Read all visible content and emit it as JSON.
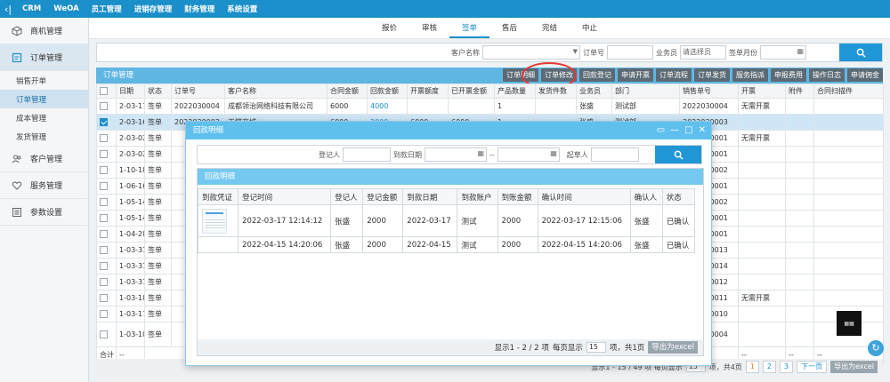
{
  "topnav": {
    "items": [
      "CRM",
      "WeOA",
      "员工管理",
      "进销存管理",
      "财务管理",
      "系统设置"
    ]
  },
  "sidebar": {
    "opportunity": "商机管理",
    "order": "订单管理",
    "subs": [
      "销售开单",
      "订单管理",
      "成本管理",
      "发货管理"
    ],
    "customer": "客户管理",
    "service": "服务管理",
    "params": "参数设置"
  },
  "tabs": [
    "报价",
    "审核",
    "签单",
    "售后",
    "完结",
    "中止"
  ],
  "search": {
    "customer_label": "客户名称",
    "order_label": "订单号",
    "sales_label": "业务员",
    "sales_placeholder": "请选择员",
    "month_label": "签单月份"
  },
  "panel": {
    "title": "订单管理"
  },
  "toolbar": [
    "订单明细",
    "订单修改",
    "回款登记",
    "申请开票",
    "订单流程",
    "订单发货",
    "服务指派",
    "申报费用",
    "操作日志",
    "申请佣金"
  ],
  "table": {
    "headers": [
      "",
      "日期",
      "状态",
      "订单号",
      "客户名称",
      "合同金额",
      "回款金额",
      "开票额度",
      "已开票金额",
      "产品数量",
      "发货件数",
      "业务员",
      "部门",
      "销售单号",
      "开票",
      "附件",
      "合同扫描件"
    ],
    "rows": [
      [
        "2-03-17",
        "签单",
        "2022030004",
        "成都领治网络科技有限公司",
        "6000",
        "4000",
        "",
        "",
        "1",
        "",
        "张盛",
        "测试部",
        "2022030004",
        "无需开票",
        "",
        ""
      ],
      [
        "2-03-16",
        "签单",
        "2022030003",
        "天猫商城",
        "6000",
        "2000",
        "6000",
        "6000",
        "1",
        "",
        "张盛",
        "测试部",
        "2022030003",
        "",
        "",
        ""
      ],
      [
        "2-03-02",
        "签单",
        "",
        "",
        "",
        "",
        "",
        "",
        "",
        "",
        "",
        "",
        "2022030001",
        "无需开票",
        "",
        ""
      ],
      [
        "2-03-02",
        "签单",
        "",
        "",
        "",
        "",
        "",
        "",
        "",
        "",
        "",
        "",
        "2022030001",
        "",
        "",
        ""
      ],
      [
        "1-10-18",
        "签单",
        "",
        "",
        "",
        "",
        "",
        "",
        "",
        "",
        "",
        "",
        "2021100002",
        "",
        "",
        ""
      ],
      [
        "1-06-16",
        "签单",
        "",
        "",
        "",
        "",
        "",
        "",
        "",
        "",
        "",
        "",
        "2021060001",
        "",
        "",
        ""
      ],
      [
        "1-05-14",
        "签单",
        "",
        "",
        "",
        "",
        "",
        "",
        "",
        "",
        "",
        "",
        "2021050002",
        "",
        "",
        ""
      ],
      [
        "1-05-14",
        "签单",
        "",
        "",
        "",
        "",
        "",
        "",
        "",
        "",
        "",
        "",
        "2021050001",
        "",
        "",
        ""
      ],
      [
        "1-04-28",
        "签单",
        "",
        "",
        "",
        "",
        "",
        "",
        "",
        "",
        "",
        "",
        "2021040001",
        "",
        "",
        ""
      ],
      [
        "1-03-31",
        "签单",
        "",
        "",
        "",
        "",
        "",
        "",
        "",
        "",
        "",
        "",
        "2021030013",
        "",
        "",
        ""
      ],
      [
        "1-03-31",
        "签单",
        "",
        "",
        "",
        "",
        "",
        "",
        "",
        "",
        "",
        "",
        "2021030014",
        "",
        "",
        ""
      ],
      [
        "1-03-31",
        "签单",
        "",
        "",
        "",
        "",
        "",
        "",
        "",
        "",
        "",
        "",
        "2021030012",
        "",
        "",
        ""
      ],
      [
        "1-03-18",
        "签单",
        "",
        "",
        "",
        "",
        "",
        "",
        "",
        "",
        "",
        "",
        "2021030011",
        "无需开票",
        "",
        ""
      ],
      [
        "1-03-17",
        "签单",
        "",
        "",
        "",
        "",
        "",
        "",
        "",
        "",
        "",
        "",
        "2021030010",
        "",
        "",
        ""
      ],
      [
        "1-03-10",
        "签单",
        "",
        "",
        "",
        "",
        "",
        "",
        "",
        "",
        "",
        "",
        "2021030004",
        "",
        "",
        ""
      ]
    ],
    "total_label": "合计",
    "total_dash": "--"
  },
  "pager": {
    "text": "显示1 - 15 / 49 项 每页显示",
    "per": "15",
    "pages_text": "项，共4页",
    "p1": "1",
    "p2": "2",
    "p3": "3",
    "next": "下一页",
    "export": "导出为excel"
  },
  "modal": {
    "title": "回款明细",
    "search": {
      "reg_label": "登记人",
      "date_label": "到款日期",
      "sep": "--",
      "start_label": "起草人"
    },
    "sub_title": "回款明细",
    "headers": [
      "到款凭证",
      "登记时间",
      "登记人",
      "登记金额",
      "到款日期",
      "到款账户",
      "到账金额",
      "确认时间",
      "确认人",
      "状态"
    ],
    "rows": [
      [
        "",
        "2022-03-17 12:14:12",
        "张盛",
        "2000",
        "2022-03-17",
        "测试",
        "2000",
        "2022-03-17 12:15:06",
        "张盛",
        "已确认"
      ],
      [
        "",
        "2022-04-15 14:20:06",
        "张盛",
        "2000",
        "2022-04-15",
        "测试",
        "2000",
        "2022-04-15 14:20:06",
        "张盛",
        "已确认"
      ]
    ],
    "pager": {
      "text": "显示1 - 2 / 2 项",
      "per_label": "每页显示",
      "per": "15",
      "pages": "项，共1页",
      "export": "导出为excel"
    }
  },
  "icons": {
    "search": "search-icon",
    "calendar": "calendar-icon"
  }
}
